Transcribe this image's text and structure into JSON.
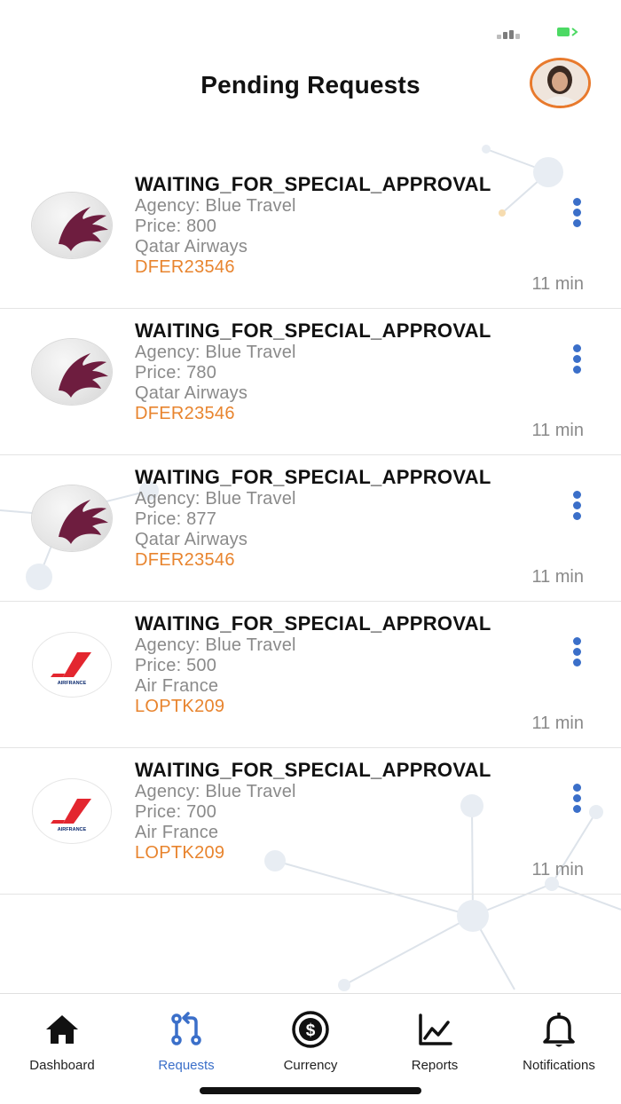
{
  "header": {
    "title": "Pending Requests"
  },
  "requests": [
    {
      "status": "WAITING_FOR_SPECIAL_APPROVAL",
      "agency": "Agency: Blue Travel",
      "price": "Price: 800",
      "airline": "Qatar Airways",
      "code": "DFER23546",
      "time": "11 min",
      "logo": "qatar-airways-logo"
    },
    {
      "status": "WAITING_FOR_SPECIAL_APPROVAL",
      "agency": "Agency: Blue Travel",
      "price": "Price: 780",
      "airline": "Qatar Airways",
      "code": "DFER23546",
      "time": "11 min",
      "logo": "qatar-airways-logo"
    },
    {
      "status": "WAITING_FOR_SPECIAL_APPROVAL",
      "agency": "Agency: Blue Travel",
      "price": "Price: 877",
      "airline": "Qatar Airways",
      "code": "DFER23546",
      "time": "11 min",
      "logo": "qatar-airways-logo"
    },
    {
      "status": "WAITING_FOR_SPECIAL_APPROVAL",
      "agency": "Agency: Blue Travel",
      "price": "Price: 500",
      "airline": "Air France",
      "code": "LOPTK209",
      "time": "11 min",
      "logo": "air-france-logo"
    },
    {
      "status": "WAITING_FOR_SPECIAL_APPROVAL",
      "agency": "Agency: Blue Travel",
      "price": "Price: 700",
      "airline": "Air France",
      "code": "LOPTK209",
      "time": "11 min",
      "logo": "air-france-logo"
    }
  ],
  "logos": {
    "air_france_wordmark": "AIRFRANCE"
  },
  "tabs": [
    {
      "label": "Dashboard",
      "icon": "home-icon",
      "active": false
    },
    {
      "label": "Requests",
      "icon": "requests-icon",
      "active": true
    },
    {
      "label": "Currency",
      "icon": "dollar-icon",
      "active": false
    },
    {
      "label": "Reports",
      "icon": "chart-icon",
      "active": false
    },
    {
      "label": "Notifications",
      "icon": "bell-icon",
      "active": false
    }
  ],
  "colors": {
    "accent": "#3b6fc9",
    "code": "#e8842e",
    "qatar": "#6e1d3f",
    "airfrance": "#e3262f",
    "avatar_ring": "#e87a2d"
  }
}
